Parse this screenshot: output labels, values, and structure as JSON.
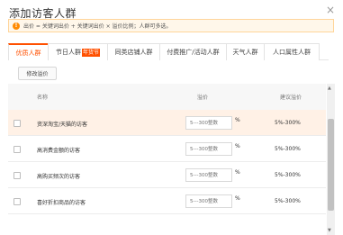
{
  "dialog": {
    "title": "添加访客人群",
    "close_symbol": "×"
  },
  "notice": {
    "icon_text": "!",
    "text": "出价 = 关键词出价 + 关键词出价 × 溢价比例；人群可多选。"
  },
  "tabs": [
    {
      "label": "优质人群",
      "active": true
    },
    {
      "label": "节日人群",
      "badge": "年货节"
    },
    {
      "label": "同类店铺人群"
    },
    {
      "label": "付费推广/活动人群"
    },
    {
      "label": "天气人群"
    },
    {
      "label": "人口属性人群"
    }
  ],
  "edit_button": {
    "label": "修改溢价"
  },
  "table": {
    "headers": {
      "name": "名称",
      "bid": "溢价",
      "suggest": "建议溢价"
    },
    "rows": [
      {
        "name": "资深淘宝/天猫的访客",
        "placeholder": "5---300整数",
        "percent": "%",
        "suggest": "5%-300%"
      },
      {
        "name": "高消费金额的访客",
        "placeholder": "5---300整数",
        "percent": "%",
        "suggest": "5%-300%"
      },
      {
        "name": "高购买频次的访客",
        "placeholder": "5---300整数",
        "percent": "%",
        "suggest": "5%-300%"
      },
      {
        "name": "喜好折扣商品的访客",
        "placeholder": "5---300整数",
        "percent": "%",
        "suggest": "5%-300%"
      }
    ]
  },
  "scrollbar": {
    "up": "▲",
    "down": "▼"
  }
}
